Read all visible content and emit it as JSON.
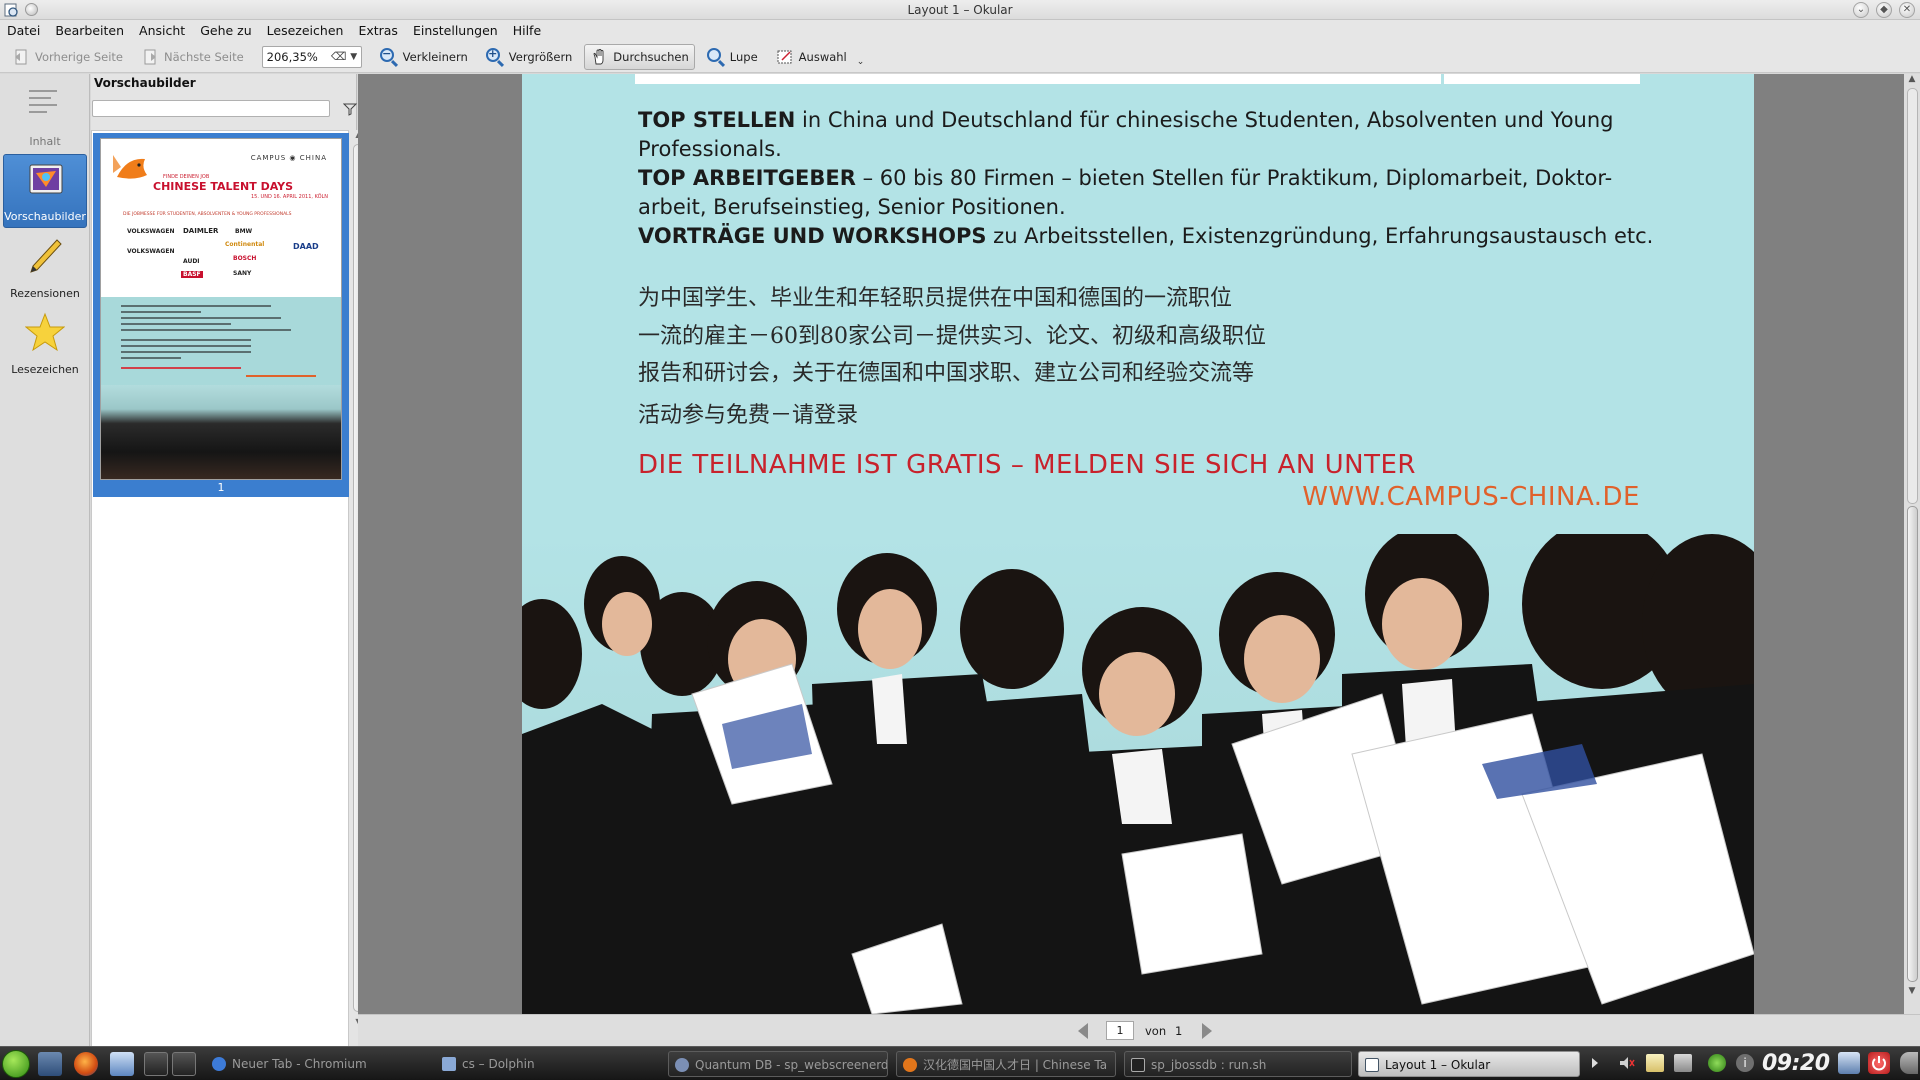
{
  "window": {
    "title": "Layout 1 – Okular"
  },
  "menubar": {
    "items": [
      {
        "label": "Datei"
      },
      {
        "label": "Bearbeiten"
      },
      {
        "label": "Ansicht"
      },
      {
        "label": "Gehe zu"
      },
      {
        "label": "Lesezeichen"
      },
      {
        "label": "Extras"
      },
      {
        "label": "Einstellungen"
      },
      {
        "label": "Hilfe"
      }
    ]
  },
  "toolbar": {
    "prev_page": "Vorherige Seite",
    "next_page": "Nächste Seite",
    "zoom_value": "206,35%",
    "zoom_out": "Verkleinern",
    "zoom_in": "Vergrößern",
    "browse": "Durchsuchen",
    "magnifier": "Lupe",
    "selection": "Auswahl"
  },
  "sidebar": {
    "items": [
      {
        "label": "Inhalt",
        "icon": "contents-icon",
        "state": "disabled"
      },
      {
        "label": "Vorschaubilder",
        "icon": "thumbnails-icon",
        "state": "active"
      },
      {
        "label": "Rezensionen",
        "icon": "pencil-icon",
        "state": "normal"
      },
      {
        "label": "Lesezeichen",
        "icon": "star-icon",
        "state": "normal"
      }
    ]
  },
  "thumbnails": {
    "title": "Vorschaubilder",
    "search_placeholder": "",
    "page_number": "1",
    "mini": {
      "brand": "CAMPUS ◉ CHINA",
      "kicker": "FINDE DEINEN JOB",
      "headline": "CHINESE TALENT DAYS",
      "date": "15. UND 16. APRIL 2011, KÖLN",
      "subline": "DIE JOBMESSE FÜR STUDENTEN, ABSOLVENTEN & YOUNG PROFESSIONALS",
      "logos": [
        "VOLKSWAGEN",
        "DAIMLER",
        "BMW",
        "DAAD",
        "VOLKSWAGEN",
        "Continental",
        "AUDI",
        "BOSCH",
        "BASF",
        "SANY"
      ]
    }
  },
  "document": {
    "lines": [
      {
        "bold": "TOP STELLEN",
        "rest": " in China und Deutschland für chinesische Studenten, Absolventen und Young"
      },
      {
        "bold": "",
        "rest": "Professionals."
      },
      {
        "bold": "TOP ARBEITGEBER",
        "rest": " – 60 bis 80 Firmen – bieten Stellen für Praktikum, Diplomarbeit, Doktor-"
      },
      {
        "bold": "",
        "rest": "arbeit, Berufseinstieg, Senior Positionen."
      },
      {
        "bold": "VORTRÄGE UND WORKSHOPS",
        "rest": " zu Arbeitsstellen, Existenzgründung, Erfahrungsaustausch etc."
      }
    ],
    "chinese": [
      "为中国学生、毕业生和年轻职员提供在中国和德国的一流职位",
      "一流的雇主－60到80家公司－提供实习、论文、初级和高级职位",
      "报告和研讨会，关于在德国和中国求职、建立公司和经验交流等",
      "活动参与免费－请登录"
    ],
    "cta": "DIE TEILNAHME IST GRATIS – MELDEN SIE SICH AN UNTER",
    "url": "WWW.CAMPUS-CHINA.DE"
  },
  "pagenav": {
    "current": "1",
    "of_label": "von",
    "total": "1"
  },
  "taskbar": {
    "tasks": [
      {
        "label": "Neuer Tab - Chromium",
        "icon": "chromium-icon"
      },
      {
        "label": "cs – Dolphin",
        "icon": "dolphin-icon"
      },
      {
        "label": "Quantum DB - sp_webscreenerdata",
        "icon": "quantum-icon"
      },
      {
        "label": "汉化德国中国人才日 | Chinese Ta",
        "icon": "firefox-icon"
      },
      {
        "label": "sp_jbossdb : run.sh",
        "icon": "terminal-icon"
      },
      {
        "label": "Layout 1 – Okular",
        "icon": "okular-icon"
      }
    ],
    "clock": "09:20"
  },
  "colors": {
    "poster_bg": "#b3e3e6",
    "cta_red": "#c8222c",
    "url_orange": "#e0612b",
    "selection_blue": "#3b7ecf"
  }
}
